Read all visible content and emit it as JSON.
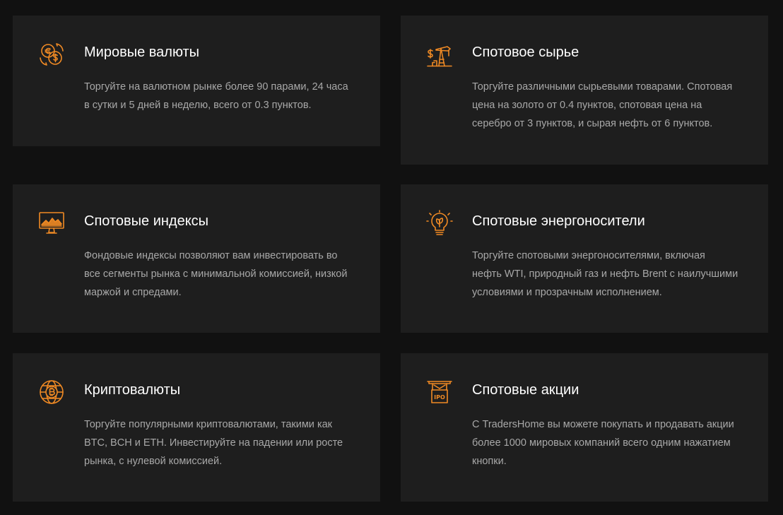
{
  "theme": {
    "background": "#111111",
    "card_background": "#1e1e1e",
    "accent": "#f08a24",
    "title_color": "#ffffff",
    "text_color": "#a8a8a8"
  },
  "cards": [
    {
      "icon": "currency-exchange-icon",
      "title": "Мировые валюты",
      "lines": [
        "Торгуйте на валютном рынке более 90 парами, 24 часа",
        "в сутки и 5 дней в неделю, всего от 0.3 пунктов."
      ]
    },
    {
      "icon": "oil-pump-icon",
      "title": "Спотовое сырье",
      "lines": [
        "Торгуйте различными сырьевыми товарами. Спотовая",
        "цена на золото от 0.4 пунктов, спотовая цена на",
        "серебро от 3 пунктов, и сырая нефть от 6 пунктов."
      ]
    },
    {
      "icon": "chart-monitor-icon",
      "title": "Спотовые индексы",
      "lines": [
        "Фондовые индексы позволяют вам инвестировать во",
        "все сегменты рынка с минимальной комиссией, низкой",
        "маржой и спредами."
      ]
    },
    {
      "icon": "eco-lightbulb-icon",
      "title": "Спотовые энергоносители",
      "lines": [
        "Торгуйте спотовыми энергоносителями, включая",
        "нефть WTI, природный газ и нефть Brent с наилучшими",
        "условиями и прозрачным исполнением."
      ]
    },
    {
      "icon": "bitcoin-globe-icon",
      "title": "Криптовалюты",
      "lines": [
        "Торгуйте популярными криптовалютами, такими как",
        "BTC, BCH и ETH. Инвестируйте на падении или росте",
        "рынка, с нулевой комиссией."
      ]
    },
    {
      "icon": "ipo-sign-icon",
      "icon_text": "IPO",
      "title": "Спотовые акции",
      "lines": [
        "С TradersHome вы можете покупать и продавать акции",
        "более 1000 мировых компаний всего одним нажатием",
        "кнопки."
      ]
    }
  ]
}
